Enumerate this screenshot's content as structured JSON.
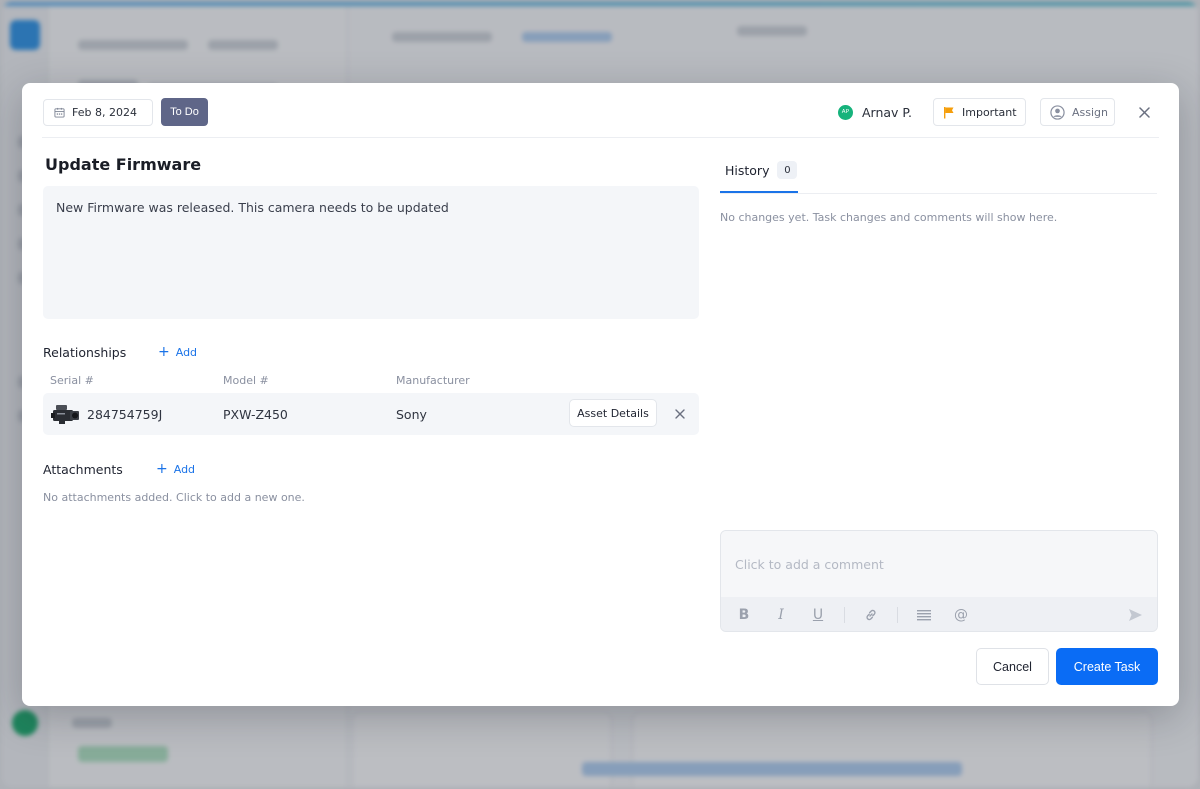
{
  "modal": {
    "header": {
      "date": "Feb 8, 2024",
      "status": "To Do",
      "assignee": {
        "initials": "AP",
        "name": "Arnav P."
      },
      "priority_label": "Important",
      "assign_label": "Assign"
    },
    "task": {
      "title": "Update Firmware",
      "description": "New Firmware was released. This camera needs to be updated"
    },
    "relationships": {
      "label": "Relationships",
      "add_label": "Add",
      "columns": [
        "Serial #",
        "Model #",
        "Manufacturer"
      ],
      "rows": [
        {
          "serial": "284754759J",
          "model": "PXW-Z450",
          "manufacturer": "Sony",
          "action_label": "Asset Details"
        }
      ]
    },
    "attachments": {
      "label": "Attachments",
      "add_label": "Add",
      "empty_text": "No attachments added. Click to add a new one."
    },
    "history": {
      "tab_label": "History",
      "count": "0",
      "empty_text": "No changes yet. Task changes and comments will show here."
    },
    "comment": {
      "placeholder": "Click to add a comment",
      "toolbar": {
        "bold": "B",
        "italic": "I",
        "underline": "U",
        "mention": "@"
      }
    },
    "footer": {
      "cancel_label": "Cancel",
      "create_label": "Create Task"
    },
    "colors": {
      "primary": "#0a6cf5",
      "status_chip": "#5f6688",
      "priority_flag": "#f59e0b",
      "avatar": "#16b37c"
    }
  }
}
